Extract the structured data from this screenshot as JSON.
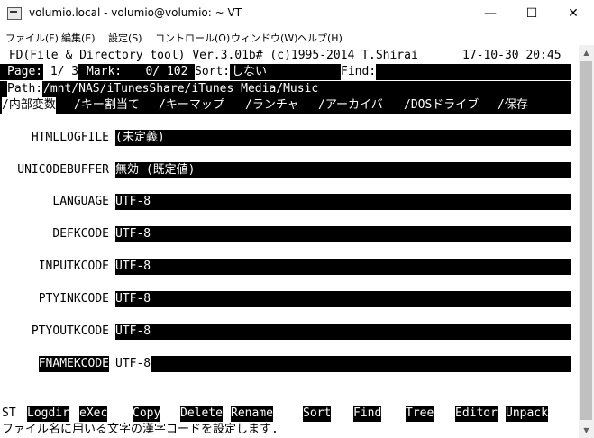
{
  "window": {
    "title": "volumio.local - volumio@volumio: ~ VT",
    "minimize_glyph": "—",
    "maximize_glyph": "☐",
    "close_glyph": "✕"
  },
  "menu": [
    "ファイル(F)",
    "編集(E)",
    "設定(S)",
    "コントロール(O)",
    "ウィンドウ(W)",
    "ヘルプ(H)"
  ],
  "header": {
    "program": " FD(File & Directory tool) Ver.3.01b# (c)1995-2014 T.Shirai",
    "datetime": "17-10-30 20:45",
    "page_label": "Page:",
    "page_value": " 1/ 3",
    "mark_label": "Mark:",
    "mark_value": "   0/ 102",
    "sort_label": "Sort:",
    "sort_value": "しない",
    "find_label": "Find:",
    "path_label": "Path:",
    "path_value": "/mnt/NAS/iTunesShare/iTunes Media/Music"
  },
  "tabs": [
    "/内部変数",
    "/キー割当て",
    "/キーマップ",
    "/ランチャ",
    "/アーカイバ",
    "/DOSドライブ",
    "/保存"
  ],
  "variables": [
    {
      "name": "HTMLLOGFILE",
      "value": "(未定義)"
    },
    {
      "name": "UNICODEBUFFER",
      "value": "無効 (既定値)"
    },
    {
      "name": "LANGUAGE",
      "value": "UTF-8"
    },
    {
      "name": "DEFKCODE",
      "value": "UTF-8"
    },
    {
      "name": "INPUTKCODE",
      "value": "UTF-8"
    },
    {
      "name": "PTYINKCODE",
      "value": "UTF-8"
    },
    {
      "name": "PTYOUTKCODE",
      "value": "UTF-8"
    },
    {
      "name": "FNAMEKCODE",
      "value": "UTF-8"
    }
  ],
  "function_keys": {
    "prefix": "ST",
    "keys": [
      "Logdir",
      "eXec",
      "Copy",
      "Delete",
      "Rename",
      "Sort",
      "Find",
      "Tree",
      "Editor",
      "Unpack"
    ]
  },
  "status": "ファイル名に用いる文字の漢字コードを設定します."
}
